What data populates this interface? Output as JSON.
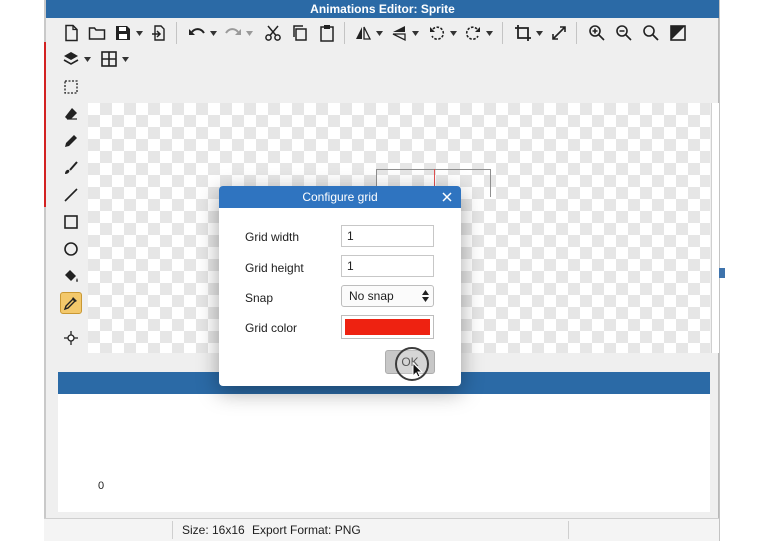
{
  "window": {
    "title": "Animations Editor: Sprite"
  },
  "toolbar": {
    "row1": [
      {
        "name": "new-file-icon"
      },
      {
        "name": "open-folder-icon"
      },
      {
        "name": "save-icon",
        "dropdown": true
      },
      {
        "name": "import-icon"
      },
      {
        "name": "undo-icon",
        "dropdown": true
      },
      {
        "name": "redo-icon",
        "dropdown": true
      },
      {
        "name": "cut-icon"
      },
      {
        "name": "copy-icon"
      },
      {
        "name": "paste-icon"
      },
      {
        "name": "flip-horizontal-icon",
        "dropdown": true
      },
      {
        "name": "flip-vertical-icon",
        "dropdown": true
      },
      {
        "name": "rotate-ccw-icon",
        "dropdown": true
      },
      {
        "name": "rotate-cw-icon",
        "dropdown": true
      },
      {
        "name": "crop-icon",
        "dropdown": true
      },
      {
        "name": "resize-icon"
      },
      {
        "name": "zoom-in-icon"
      },
      {
        "name": "zoom-out-icon"
      },
      {
        "name": "zoom-fit-icon"
      },
      {
        "name": "contrast-icon"
      }
    ],
    "row2": [
      {
        "name": "layers-icon",
        "dropdown": true
      },
      {
        "name": "grid-icon",
        "dropdown": true
      }
    ]
  },
  "tools": [
    {
      "name": "select-tool-icon"
    },
    {
      "name": "eraser-tool-icon"
    },
    {
      "name": "pencil-tool-icon"
    },
    {
      "name": "brush-tool-icon"
    },
    {
      "name": "line-tool-icon"
    },
    {
      "name": "rectangle-tool-icon"
    },
    {
      "name": "ellipse-tool-icon"
    },
    {
      "name": "fill-tool-icon"
    },
    {
      "name": "eyedropper-tool-icon",
      "active": true
    },
    {
      "name": "move-tool-icon"
    }
  ],
  "bottom_panel": {
    "frame_index": "0"
  },
  "status": {
    "size": "Size: 16x16",
    "export_format": "Export Format: PNG"
  },
  "dialog": {
    "title": "Configure grid",
    "grid_width_label": "Grid width",
    "grid_width_value": "1",
    "grid_height_label": "Grid height",
    "grid_height_value": "1",
    "snap_label": "Snap",
    "snap_value": "No snap",
    "grid_color_label": "Grid color",
    "grid_color": "#ee2211",
    "ok_label": "OK"
  },
  "colors": {
    "title_bar": "#2b6aa6",
    "dialog_title": "#2f74c0",
    "active_tool": "#f3c86b"
  }
}
